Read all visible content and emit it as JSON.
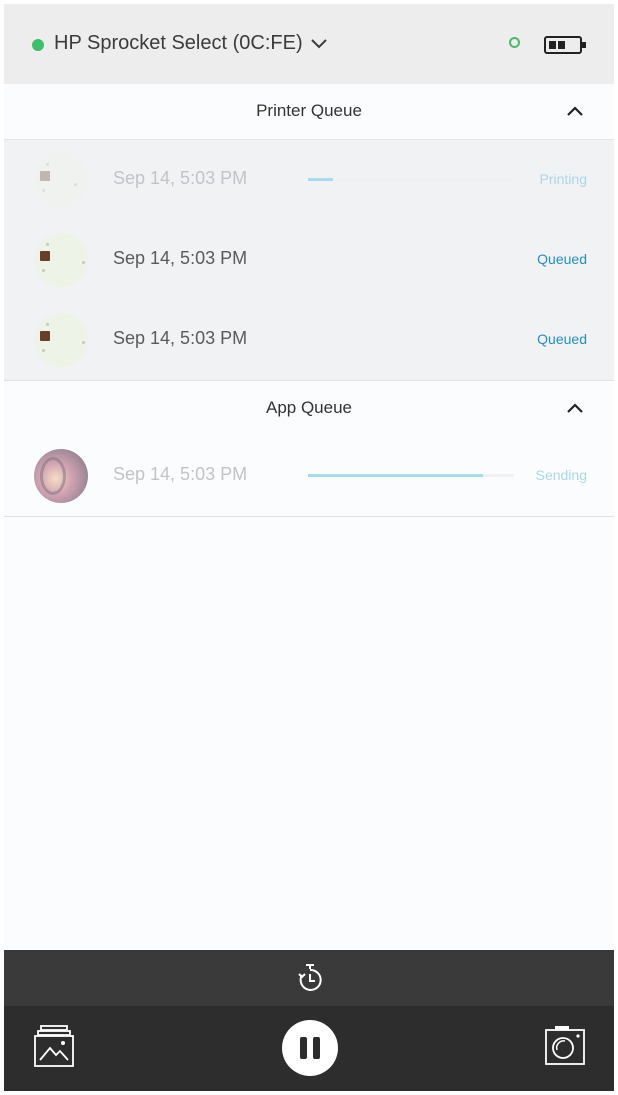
{
  "header": {
    "printer_name": "HP Sprocket Select (0C:FE)",
    "connection_status_color": "#3fbf6b",
    "icons": [
      "status-dot",
      "chevron-down-icon",
      "connection-ring-icon",
      "battery-icon"
    ]
  },
  "printer_queue": {
    "title": "Printer Queue",
    "collapse_icon": "chevron-up-icon",
    "items": [
      {
        "time": "Sep 14, 5:03 PM",
        "status": "Printing",
        "progress": 0.12
      },
      {
        "time": "Sep 14, 5:03 PM",
        "status": "Queued"
      },
      {
        "time": "Sep 14, 5:03 PM",
        "status": "Queued"
      }
    ]
  },
  "app_queue": {
    "title": "App Queue",
    "collapse_icon": "chevron-up-icon",
    "items": [
      {
        "time": "Sep 14, 5:03 PM",
        "status": "Sending",
        "progress": 0.85
      }
    ]
  },
  "footer": {
    "icons": [
      "timer-icon",
      "gallery-icon",
      "pause-icon",
      "camera-icon"
    ]
  },
  "colors": {
    "accent": "#1f8fc6",
    "progress": "#a9dbef",
    "bottom_bar": "#2d2d2d",
    "timer_bar": "#3a3a3a"
  }
}
